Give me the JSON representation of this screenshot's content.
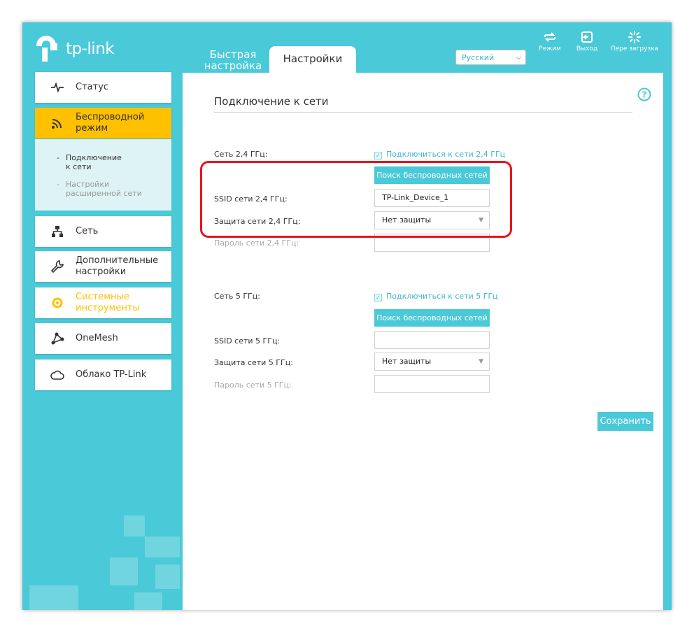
{
  "header": {
    "logo_text": "tp-link",
    "tabs": [
      {
        "label_line1": "Быстрая",
        "label_line2": "настройка"
      },
      {
        "label": "Настройки"
      }
    ],
    "language": "Русский",
    "actions": [
      {
        "label": "Режим",
        "icon": "mode-switch-icon"
      },
      {
        "label": "Выход",
        "icon": "logout-icon"
      },
      {
        "label": "Пере загрузка",
        "icon": "reboot-icon"
      }
    ]
  },
  "sidebar": {
    "items": [
      {
        "label": "Статус",
        "icon": "pulse-icon"
      },
      {
        "label_line1": "Беспроводной",
        "label_line2": "режим",
        "icon": "wifi-icon"
      },
      {
        "label": "Сеть",
        "icon": "network-icon"
      },
      {
        "label_line1": "Дополнительные",
        "label_line2": "настройки",
        "icon": "wrench-icon"
      },
      {
        "label_line1": "Системные",
        "label_line2": "инструменты",
        "icon": "gear-icon"
      },
      {
        "label": "OneMesh",
        "icon": "mesh-icon"
      },
      {
        "label": "Облако TP-Link",
        "icon": "cloud-icon"
      }
    ],
    "sub_items": [
      {
        "label_line1": "Подключение",
        "label_line2": "к сети"
      },
      {
        "label_line1": "Настройки",
        "label_line2": "расширенной сети"
      }
    ]
  },
  "main": {
    "title": "Подключение к сети",
    "net24": {
      "label": "Сеть 2,4 ГГц:",
      "connect_label": "Подключиться к сети 2,4 ГГц",
      "scan_button": "Поиск беспроводных сетей",
      "ssid_label": "SSID сети 2,4 ГГц:",
      "ssid_value": "TP-Link_Device_1",
      "security_label": "Защита сети 2,4 ГГц:",
      "security_value": "Нет защиты",
      "password_label": "Пароль сети 2,4 ГГц:",
      "password_value": ""
    },
    "net5": {
      "label": "Сеть 5 ГГц:",
      "connect_label": "Подключиться к сети 5 ГГц",
      "scan_button": "Поиск беспроводных сетей",
      "ssid_label": "SSID сети 5 ГГц:",
      "ssid_value": "",
      "security_label": "Защита сети 5 ГГц:",
      "security_value": "Нет защиты",
      "password_label": "Пароль сети 5 ГГц:",
      "password_value": ""
    },
    "save_button": "Сохранить"
  },
  "colors": {
    "accent": "#4ac9d8",
    "active": "#ffc000",
    "highlight": "#e8141a"
  }
}
